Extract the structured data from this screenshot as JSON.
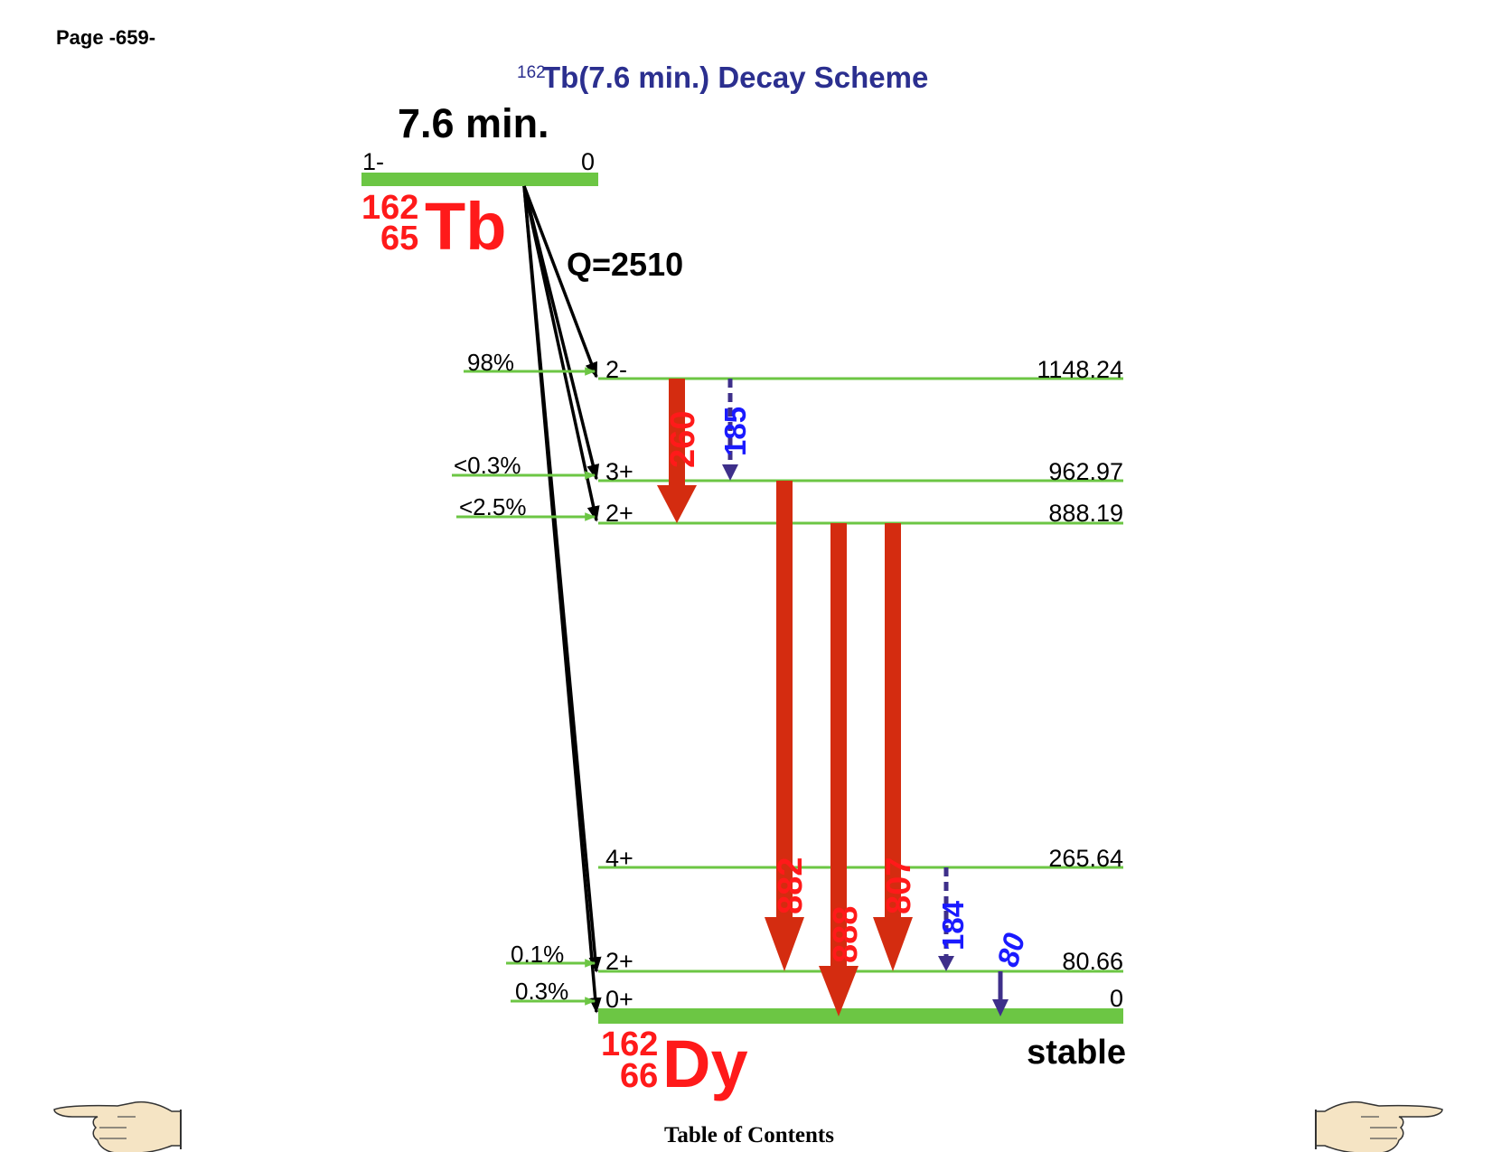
{
  "page_label": "Page -659-",
  "title": {
    "mass_superscript": "162",
    "main": "Tb(7.6 min.) Decay Scheme",
    "color": "#2b2f8f"
  },
  "parent": {
    "halflife": "7.6 min.",
    "spin": "1-",
    "energy": "0",
    "mass": "162",
    "z": "65",
    "symbol": "Tb",
    "q_value": "Q=2510"
  },
  "daughter": {
    "mass": "162",
    "z": "66",
    "symbol": "Dy",
    "stable_label": "stable"
  },
  "levels": [
    {
      "spin": "2-",
      "energy": "1148.24",
      "branch": "98%"
    },
    {
      "spin": "3+",
      "energy": "962.97",
      "branch": "<0.3%"
    },
    {
      "spin": "2+",
      "energy": "888.19",
      "branch": "<2.5%"
    },
    {
      "spin": "4+",
      "energy": "265.64",
      "branch": ""
    },
    {
      "spin": "2+",
      "energy": "80.66",
      "branch": "0.1%"
    },
    {
      "spin": "0+",
      "energy": "0",
      "branch": "0.3%"
    }
  ],
  "gammas": [
    {
      "label": "260",
      "intensity": "strong"
    },
    {
      "label": "185",
      "intensity": "weak"
    },
    {
      "label": "882",
      "intensity": "strong"
    },
    {
      "label": "888",
      "intensity": "strong"
    },
    {
      "label": "807",
      "intensity": "strong"
    },
    {
      "label": "184",
      "intensity": "weak"
    },
    {
      "label": "80",
      "intensity": "weak"
    }
  ],
  "footer": {
    "toc_link": "Table of Contents",
    "left_icon": "pointing-hand-left-icon",
    "right_icon": "pointing-hand-right-icon"
  },
  "colors": {
    "level_line": "#6cc644",
    "strong_gamma": "#d42c10",
    "strong_label": "#ff1a1a",
    "weak_gamma": "#3e2f8a",
    "weak_label": "#1a1aff",
    "nuclide": "#ff1a1a",
    "hand_fill": "#f5e4c4"
  }
}
